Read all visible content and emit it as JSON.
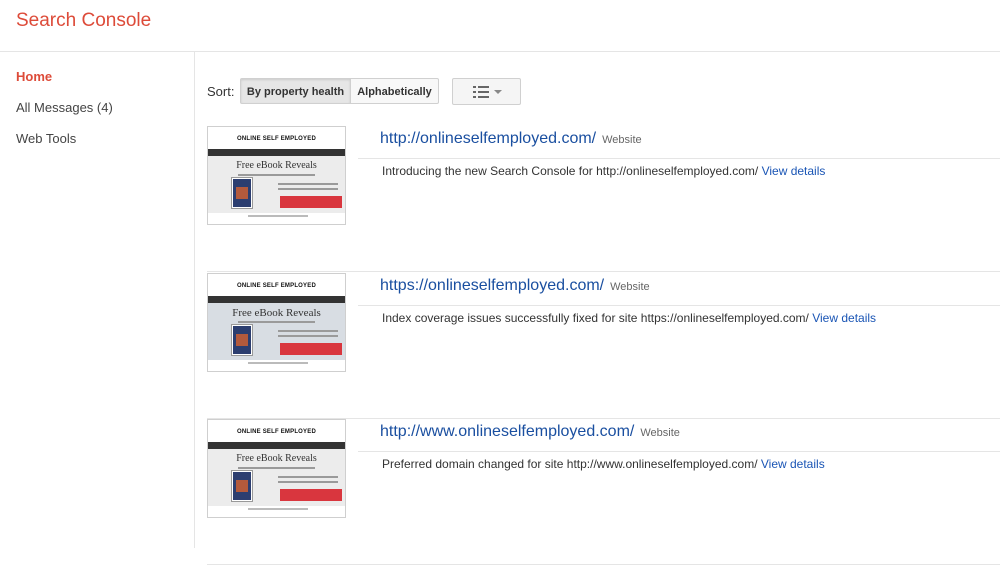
{
  "app": {
    "title": "Search Console"
  },
  "sidebar": {
    "items": [
      {
        "label": "Home",
        "active": true
      },
      {
        "label": "All Messages (4)",
        "active": false
      },
      {
        "label": "Web Tools",
        "active": false
      }
    ]
  },
  "toolbar": {
    "sort_label": "Sort:",
    "sort_options": [
      {
        "label": "By property health",
        "selected": true
      },
      {
        "label": "Alphabetically",
        "selected": false
      }
    ],
    "view_icon": "list-view-icon"
  },
  "sites": [
    {
      "url": "http://onlineselfemployed.com/",
      "type": "Website",
      "message": "Introducing the new Search Console for http://onlineselfemployed.com/",
      "link": "View details",
      "thumbnail": {
        "logo": "ONLINE SELF EMPLOYED",
        "headline": "Free eBook Reveals"
      }
    },
    {
      "url": "https://onlineselfemployed.com/",
      "type": "Website",
      "message": "Index coverage issues successfully fixed for site https://onlineselfemployed.com/",
      "link": "View details",
      "thumbnail": {
        "logo": "ONLINE SELF EMPLOYED",
        "headline": "Free eBook Reveals"
      }
    },
    {
      "url": "http://www.onlineselfemployed.com/",
      "type": "Website",
      "message": "Preferred domain changed for site http://www.onlineselfemployed.com/",
      "link": "View details",
      "thumbnail": {
        "logo": "ONLINE SELF EMPLOYED",
        "headline": "Free eBook Reveals"
      }
    }
  ],
  "colors": {
    "brand": "#dd4b39",
    "link": "#1a4fa0",
    "divider": "#e5e5e5"
  }
}
